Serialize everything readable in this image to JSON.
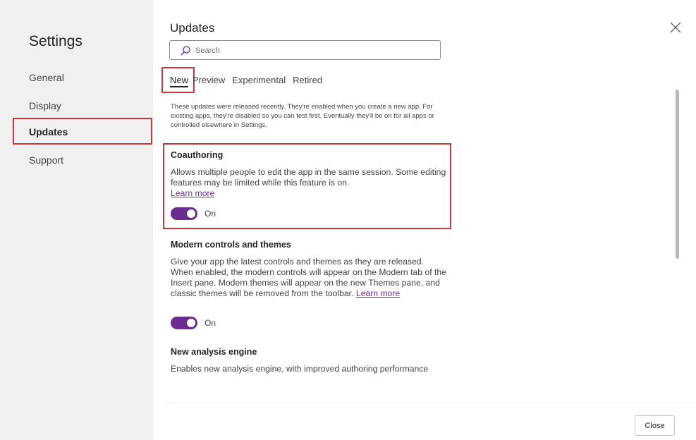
{
  "sidebar": {
    "title": "Settings",
    "items": [
      {
        "label": "General"
      },
      {
        "label": "Display"
      },
      {
        "label": "Updates"
      },
      {
        "label": "Support"
      }
    ],
    "selected_item": "Updates"
  },
  "panel": {
    "title": "Updates",
    "search": {
      "placeholder": "Search",
      "value": ""
    },
    "tabs": [
      {
        "label": "New",
        "active": true
      },
      {
        "label": "Preview",
        "active": false
      },
      {
        "label": "Experimental",
        "active": false
      },
      {
        "label": "Retired",
        "active": false
      }
    ],
    "intro": "These updates were released recently. They're enabled when you create a new app. For existing apps, they're disabled so you can test first. Eventually they'll be on for all apps or controlled elsewhere in Settings.",
    "features": [
      {
        "title": "Coauthoring",
        "description": "Allows multiple people to edit the app in the same session. Some editing features may be limited while this feature is on.",
        "learn_more": "Learn more",
        "toggle_state": "On"
      },
      {
        "title": "Modern controls and themes",
        "description": "Give your app the latest controls and themes as they are released. When enabled, the modern controls will appear on the Modern tab of the Insert pane. Modern themes will appear on the new Themes pane, and classic themes will be removed from the toolbar.",
        "learn_more": "Learn more",
        "toggle_state": "On"
      },
      {
        "title": "New analysis engine",
        "description": "Enables new analysis engine, with improved authoring performance"
      }
    ]
  },
  "footer": {
    "close_label": "Close"
  },
  "colors": {
    "accent": "#6b2c91",
    "highlight": "#d13438",
    "sidebar_bg": "#f0f0f0"
  },
  "icons": {
    "search": "search-icon",
    "dismiss": "close-icon"
  }
}
